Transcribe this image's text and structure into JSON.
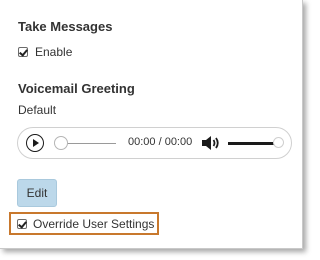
{
  "take_messages": {
    "title": "Take Messages",
    "enable_label": "Enable",
    "enable_checked": true
  },
  "voicemail_greeting": {
    "title": "Voicemail Greeting",
    "greeting_value": "Default",
    "player": {
      "time": "00:00 / 00:00",
      "progress": 0,
      "volume": 0.85,
      "play_icon": "play-icon",
      "volume_icon": "speaker-volume-icon"
    }
  },
  "edit_button_label": "Edit",
  "override": {
    "label": "Override User Settings",
    "checked": true,
    "highlight_color": "#c8782d"
  },
  "colors": {
    "button_bg": "#bcd8ea",
    "text": "#333333"
  }
}
